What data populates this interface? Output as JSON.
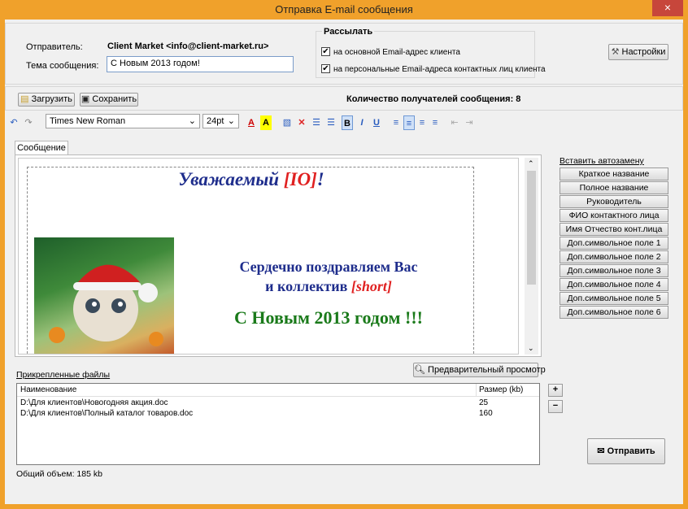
{
  "window": {
    "title": "Отправка E-mail сообщения",
    "close": "×"
  },
  "header": {
    "sender_label": "Отправитель:",
    "sender_value": "Client Market <info@client-market.ru>",
    "subject_label": "Тема сообщения:",
    "subject_value": "С Новым 2013 годом!",
    "send_to_title": "Рассылать",
    "send_main": "на основной Email-адрес клиента",
    "send_personal": "на персональные Email-адреса контактных лиц клиента",
    "settings_button": "Настройки"
  },
  "actions": {
    "load_button": "Загрузить",
    "save_button": "Сохранить",
    "recipients_count": "Количество получателей сообщения: 8"
  },
  "toolbar": {
    "font": "Times New Roman",
    "size": "24pt"
  },
  "tab": {
    "label": "Сообщение"
  },
  "letter": {
    "greeting_text": "Уважаемый ",
    "greeting_tag": "[IO]",
    "greeting_end": "!",
    "line1": "Сердечно поздравляем Вас",
    "line2_text": "и коллектив ",
    "line2_tag": "[short]",
    "line3": "С Новым 2013 годом !!!"
  },
  "autoreplace": {
    "title": "Вставить автозамену",
    "items": [
      "Краткое название",
      "Полное название",
      "Руководитель",
      "ФИО контактного лица",
      "Имя Отчество конт.лица",
      "Доп.символьное поле 1",
      "Доп.символьное поле 2",
      "Доп.символьное поле 3",
      "Доп.символьное поле 4",
      "Доп.символьное поле 5",
      "Доп.символьное поле 6"
    ]
  },
  "attachments": {
    "title": "Прикрепленные файлы",
    "preview_button": "Предварительный просмотр",
    "col_name": "Наименование",
    "col_size": "Размер (kb)",
    "rows": [
      {
        "name": "D:\\Для клиентов\\Новогодняя акция.doc",
        "size": "25"
      },
      {
        "name": "D:\\Для клиентов\\Полный каталог товаров.doc",
        "size": "160"
      }
    ],
    "total": "Общий объем: 185 kb"
  },
  "send_button": "Отправить"
}
